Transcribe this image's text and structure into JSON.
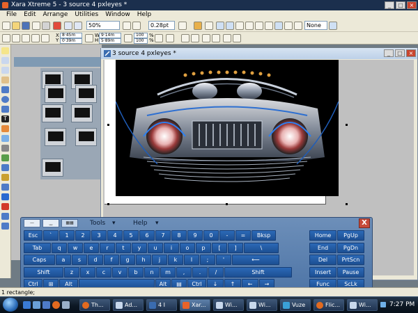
{
  "window": {
    "title": "Xara Xtreme 5 - 3 source 4 pxleyes *"
  },
  "menubar": [
    "File",
    "Edit",
    "Arrange",
    "Utilities",
    "Window",
    "Help"
  ],
  "toolbar1": {
    "zoom_value": "50%",
    "line_width_value": "0.28pt",
    "fill_value": "None"
  },
  "toolbar2": {
    "x_value": "8·45m",
    "y_value": "0·39m",
    "w_value": "9·14m",
    "h_value": "5·89m",
    "scale_x_value": "100",
    "scale_y_value": "100",
    "x_label": "X",
    "y_label": "Y",
    "w_label": "W",
    "h_label": "H",
    "pct_label": "%"
  },
  "document": {
    "title": "3 source 4 pxleyes *"
  },
  "keyboard": {
    "menu_tools": "Tools",
    "menu_help": "Help",
    "close_label": "X",
    "rows": [
      [
        "Esc",
        "`",
        "1",
        "2",
        "3",
        "4",
        "5",
        "6",
        "7",
        "8",
        "9",
        "0",
        "-",
        "=",
        "Bksp"
      ],
      [
        "Tab",
        "q",
        "w",
        "e",
        "r",
        "t",
        "y",
        "u",
        "i",
        "o",
        "p",
        "[",
        "]",
        "\\"
      ],
      [
        "Caps",
        "a",
        "s",
        "d",
        "f",
        "g",
        "h",
        "j",
        "k",
        "l",
        ";",
        "'",
        "⟵"
      ],
      [
        "Shift",
        "z",
        "x",
        "c",
        "v",
        "b",
        "n",
        "m",
        ",",
        ".",
        "/",
        "Shift"
      ],
      [
        "Ctrl",
        "⊞",
        "Alt",
        "",
        "Alt",
        "▤",
        "Ctrl",
        "↓",
        "↑",
        "←",
        "→"
      ]
    ],
    "side_keys": [
      [
        "Home",
        "PgUp"
      ],
      [
        "End",
        "PgDn"
      ],
      [
        "Del",
        "PrtScn"
      ],
      [
        "Insert",
        "Pause"
      ],
      [
        "Func",
        "ScLk"
      ]
    ]
  },
  "status": {
    "text": "1 rectangle;"
  },
  "taskbar": {
    "items": [
      "Th...",
      "Ad...",
      "4 I",
      "Xar...",
      "Wi...",
      "Wi...",
      "Vuze",
      "Flic...",
      "Wi..."
    ],
    "clock": "7:27 PM"
  },
  "colors": {
    "titlebar": "#1b2f4d",
    "key": "#1c4f93",
    "taskbar": "#0d1824",
    "canvas": "#c0c0c0"
  }
}
